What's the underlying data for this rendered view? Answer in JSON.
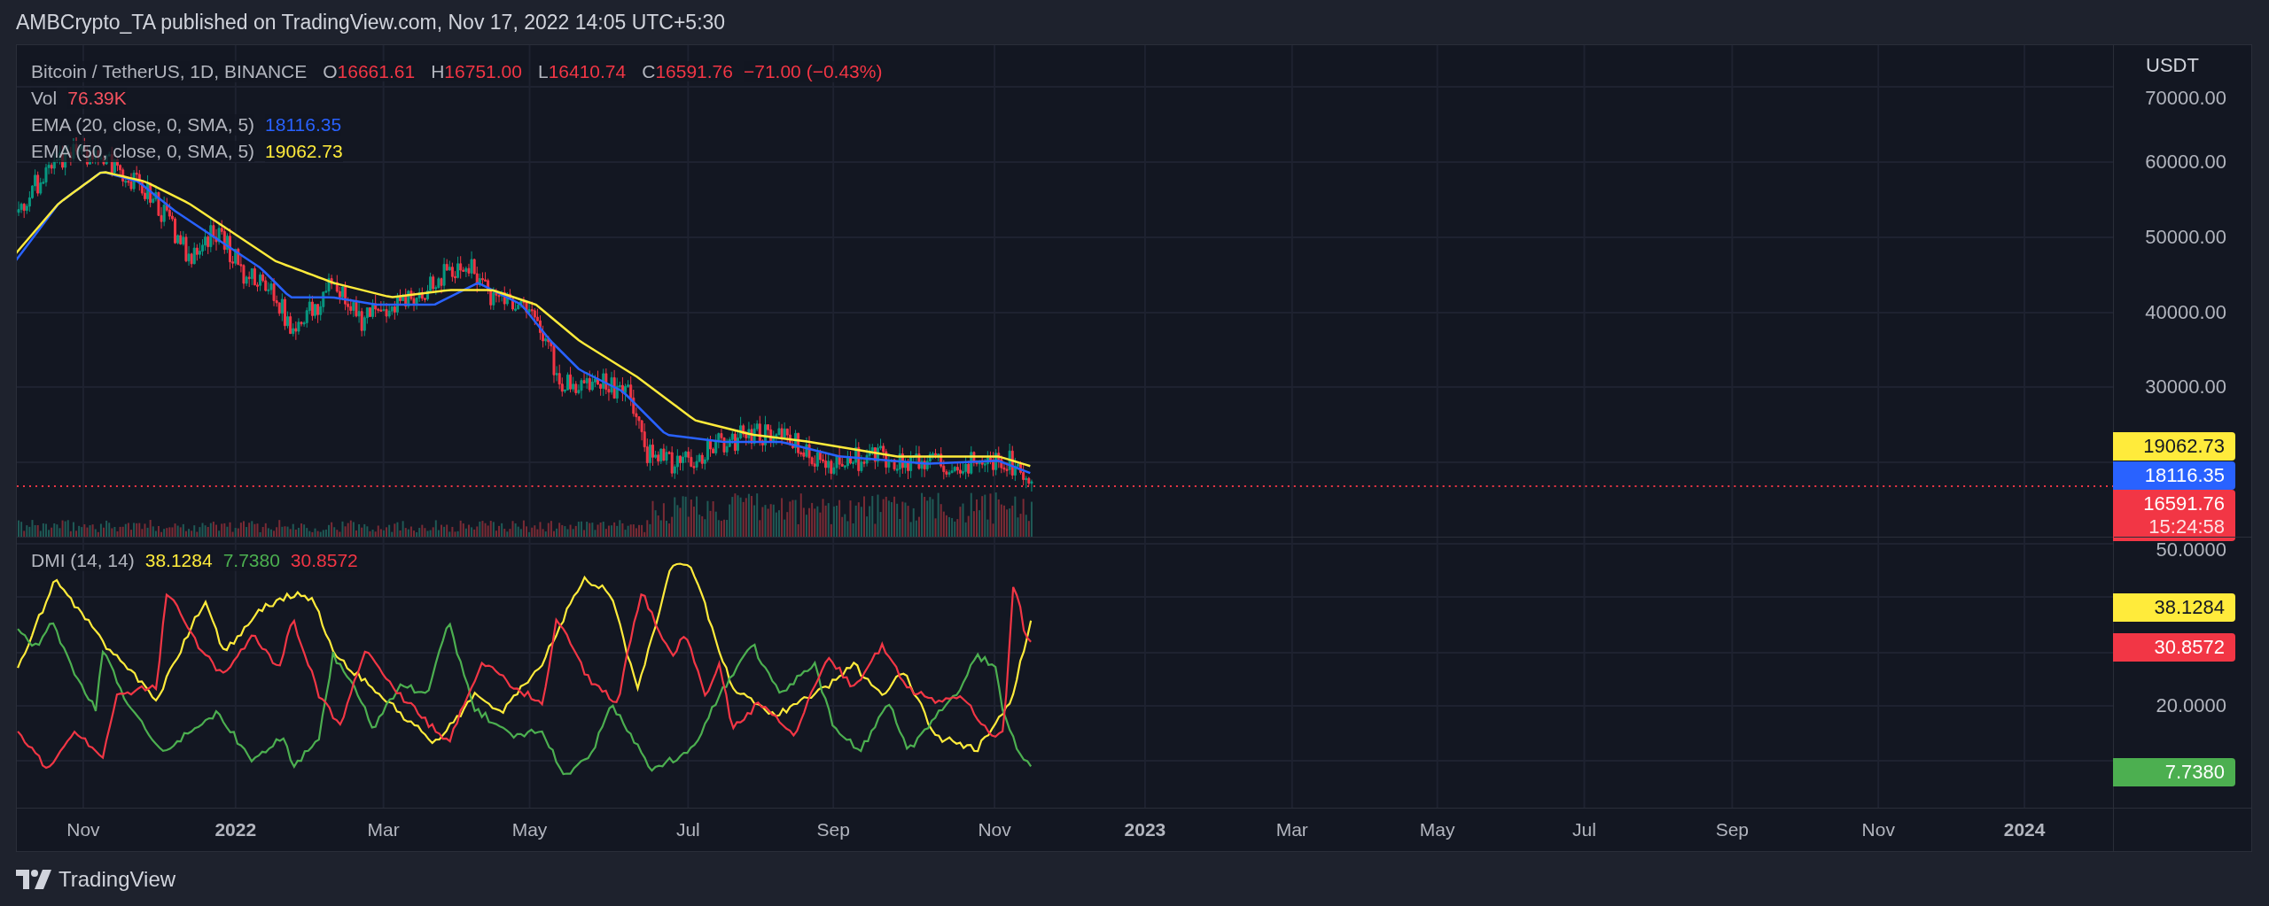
{
  "header": "AMBCrypto_TA published on TradingView.com, Nov 17, 2022 14:05 UTC+5:30",
  "symbol_legend": {
    "title": "Bitcoin / TetherUS, 1D, BINANCE",
    "ohlc": [
      {
        "prefix": "O",
        "value": "16661.61"
      },
      {
        "prefix": "H",
        "value": "16751.00"
      },
      {
        "prefix": "L",
        "value": "16410.74"
      },
      {
        "prefix": "C",
        "value": "16591.76"
      }
    ],
    "change": "−71.00 (−0.43%)"
  },
  "volume_legend": {
    "label": "Vol",
    "value": "76.39K"
  },
  "indicators": [
    {
      "label": "EMA (20, close, 0, SMA, 5)",
      "value": "18116.35",
      "color": "#2962ff"
    },
    {
      "label": "EMA (50, close, 0, SMA, 5)",
      "value": "19062.73",
      "color": "#ffeb3b"
    }
  ],
  "price_axis": {
    "unit": "USDT",
    "ticks": [
      "70000.00",
      "60000.00",
      "50000.00",
      "40000.00",
      "30000.00"
    ],
    "badges": [
      {
        "value": "19062.73",
        "color": "#ffeb3b"
      },
      {
        "value": "18116.35",
        "color": "#2962ff"
      },
      {
        "value": "16591.76",
        "countdown": "15:24:58",
        "color": "#f23645"
      }
    ]
  },
  "dmi_legend": {
    "label": "DMI (14, 14)",
    "values": [
      {
        "value": "38.1284",
        "color": "#ffeb3b"
      },
      {
        "value": "7.7380",
        "color": "#4caf50"
      },
      {
        "value": "30.8572",
        "color": "#f23645"
      }
    ]
  },
  "dmi_axis": {
    "ticks": [
      "50.0000",
      "20.0000"
    ],
    "badges": [
      {
        "value": "38.1284",
        "color": "#ffeb3b"
      },
      {
        "value": "30.8572",
        "color": "#f23645"
      },
      {
        "value": "7.7380",
        "color": "#4caf50"
      }
    ]
  },
  "time_axis": [
    {
      "label": "Nov",
      "kind": "month"
    },
    {
      "label": "2022",
      "kind": "year"
    },
    {
      "label": "Mar",
      "kind": "month"
    },
    {
      "label": "May",
      "kind": "month"
    },
    {
      "label": "Jul",
      "kind": "month"
    },
    {
      "label": "Sep",
      "kind": "month"
    },
    {
      "label": "Nov",
      "kind": "month"
    },
    {
      "label": "2023",
      "kind": "year"
    },
    {
      "label": "Mar",
      "kind": "month"
    },
    {
      "label": "May",
      "kind": "month"
    },
    {
      "label": "Jul",
      "kind": "month"
    },
    {
      "label": "Sep",
      "kind": "month"
    },
    {
      "label": "Nov",
      "kind": "month"
    },
    {
      "label": "2024",
      "kind": "year"
    }
  ],
  "footer": {
    "brand": "TradingView"
  }
}
